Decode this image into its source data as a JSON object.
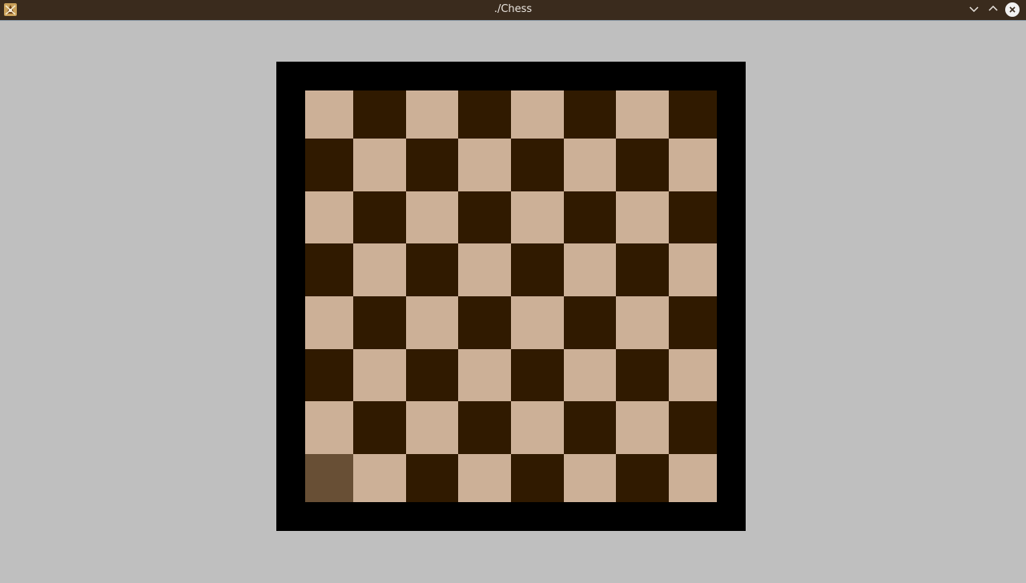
{
  "window": {
    "title": "./Chess",
    "icon": "chess-app-icon",
    "controls": [
      "minimize-icon",
      "maximize-icon",
      "close-icon"
    ]
  },
  "board": {
    "size": 8,
    "colors": {
      "light": "#ccb097",
      "dark": "#301a00",
      "selected": "#684f35",
      "frame": "#000000",
      "background": "#bfbfbf"
    },
    "selected_square": {
      "row": 7,
      "col": 0
    },
    "pieces": []
  }
}
